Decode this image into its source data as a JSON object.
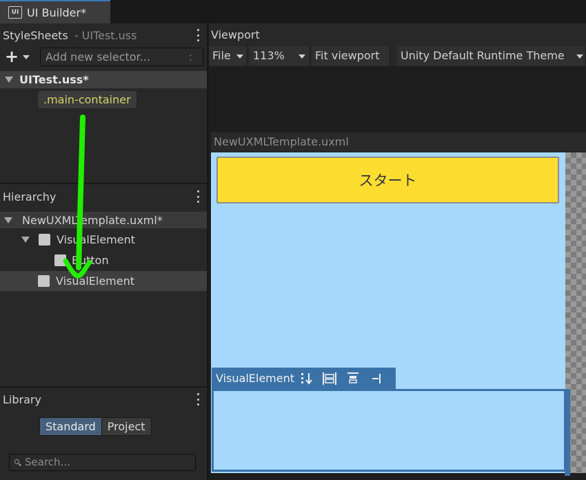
{
  "window": {
    "tab_title": "UI Builder*",
    "icon_text": "UI"
  },
  "stylesheets": {
    "header": "StyleSheets",
    "current_file": "- UITest.uss",
    "selector_placeholder": "Add new selector...",
    "selector_input_suffix": ":",
    "uss_file": "UITest.uss*",
    "selectors": [
      ".main-container"
    ]
  },
  "hierarchy": {
    "header": "Hierarchy",
    "root": "NewUXMLTemplate.uxml*",
    "items": [
      {
        "label": "VisualElement",
        "depth": 1,
        "expanded": true
      },
      {
        "label": "Button",
        "depth": 2
      },
      {
        "label": "VisualElement",
        "depth": 1,
        "selected": true
      }
    ]
  },
  "library": {
    "header": "Library",
    "tabs": [
      "Standard",
      "Project"
    ],
    "active_tab": "Standard",
    "search_placeholder": "Search..."
  },
  "viewport": {
    "header": "Viewport",
    "toolbar": {
      "file": "File",
      "zoom": "113%",
      "fit": "Fit viewport",
      "theme": "Unity Default Runtime Theme"
    },
    "document_title": "NewUXMLTemplate.uxml",
    "start_button_text": "スタート",
    "selected_label": "VisualElement"
  },
  "colors": {
    "canvas_bg": "#a6d8fe",
    "button_bg": "#fddd30",
    "selection": "#3a72a8",
    "selector_text": "#d4d36a",
    "drag_arrow": "#22ee00"
  }
}
